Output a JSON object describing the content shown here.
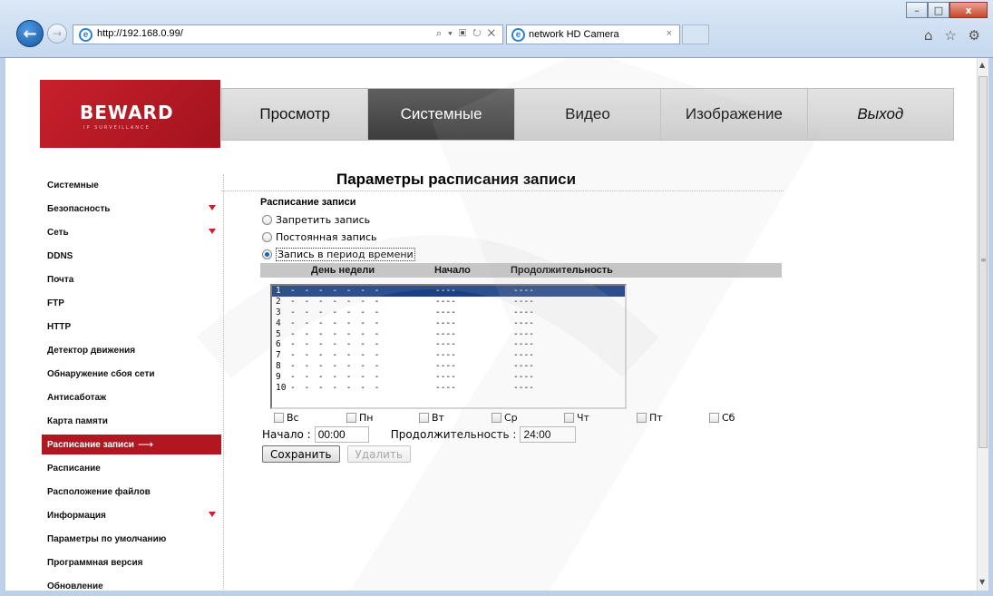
{
  "browser": {
    "address": "http://192.168.0.99/",
    "address_tools": "⌕ ▾ ▣ ↻ ✕",
    "tab_title": "network HD Camera",
    "tab_close": "×",
    "toolbar_icons": "⌂ ☆ ⚙",
    "win_min": "–",
    "win_max": "□",
    "win_close": "x",
    "back": "←",
    "forward": "→",
    "ie_glyph": "e"
  },
  "logo": {
    "brand": "BEWARD",
    "subtitle": "IP SURVEILLANCE"
  },
  "menu": [
    "Просмотр",
    "Системные",
    "Видео",
    "Изображение",
    "Выход"
  ],
  "sidebar": {
    "items": [
      "Системные",
      "Безопасность",
      "Сеть",
      "DDNS",
      "Почта",
      "FTP",
      "HTTP",
      "Детектор движения",
      "Обнаружение сбоя сети",
      "Антисаботаж",
      "Карта памяти",
      "Расписание записи",
      "Расписание",
      "Расположение файлов",
      "Информация",
      "Параметры по умолчанию",
      "Программная версия",
      "Обновление"
    ],
    "active_arrow": "⟶"
  },
  "main": {
    "title": "Параметры расписания записи",
    "section_title": "Расписание записи",
    "radios": [
      "Запретить запись",
      "Постоянная запись",
      "Запись в период времени"
    ],
    "table_headers": [
      "День недели",
      "Начало",
      "Продолжительность"
    ],
    "rows": [
      {
        "n": "1",
        "days": "- - - - - - -",
        "start": "----",
        "dur": "----"
      },
      {
        "n": "2",
        "days": "- - - - - - -",
        "start": "----",
        "dur": "----"
      },
      {
        "n": "3",
        "days": "- - - - - - -",
        "start": "----",
        "dur": "----"
      },
      {
        "n": "4",
        "days": "- - - - - - -",
        "start": "----",
        "dur": "----"
      },
      {
        "n": "5",
        "days": "- - - - - - -",
        "start": "----",
        "dur": "----"
      },
      {
        "n": "6",
        "days": "- - - - - - -",
        "start": "----",
        "dur": "----"
      },
      {
        "n": "7",
        "days": "- - - - - - -",
        "start": "----",
        "dur": "----"
      },
      {
        "n": "8",
        "days": "- - - - - - -",
        "start": "----",
        "dur": "----"
      },
      {
        "n": "9",
        "days": "- - - - - - -",
        "start": "----",
        "dur": "----"
      },
      {
        "n": "10",
        "days": "- - - - - - -",
        "start": "----",
        "dur": "----"
      }
    ],
    "days": [
      "Вс",
      "Пн",
      "Вт",
      "Ср",
      "Чт",
      "Пт",
      "Сб"
    ],
    "start_label": "Начало :",
    "start_value": "00:00",
    "duration_label": "Продолжительность :",
    "duration_value": "24:00",
    "save_label": "Сохранить",
    "delete_label": "Удалить"
  },
  "colors": {
    "brand_red": "#b01721",
    "menu_active": "#4a4a4a",
    "selection": "#1c3f86"
  },
  "scroll": {
    "up": "▲",
    "down": "▼",
    "grip": "≡"
  }
}
